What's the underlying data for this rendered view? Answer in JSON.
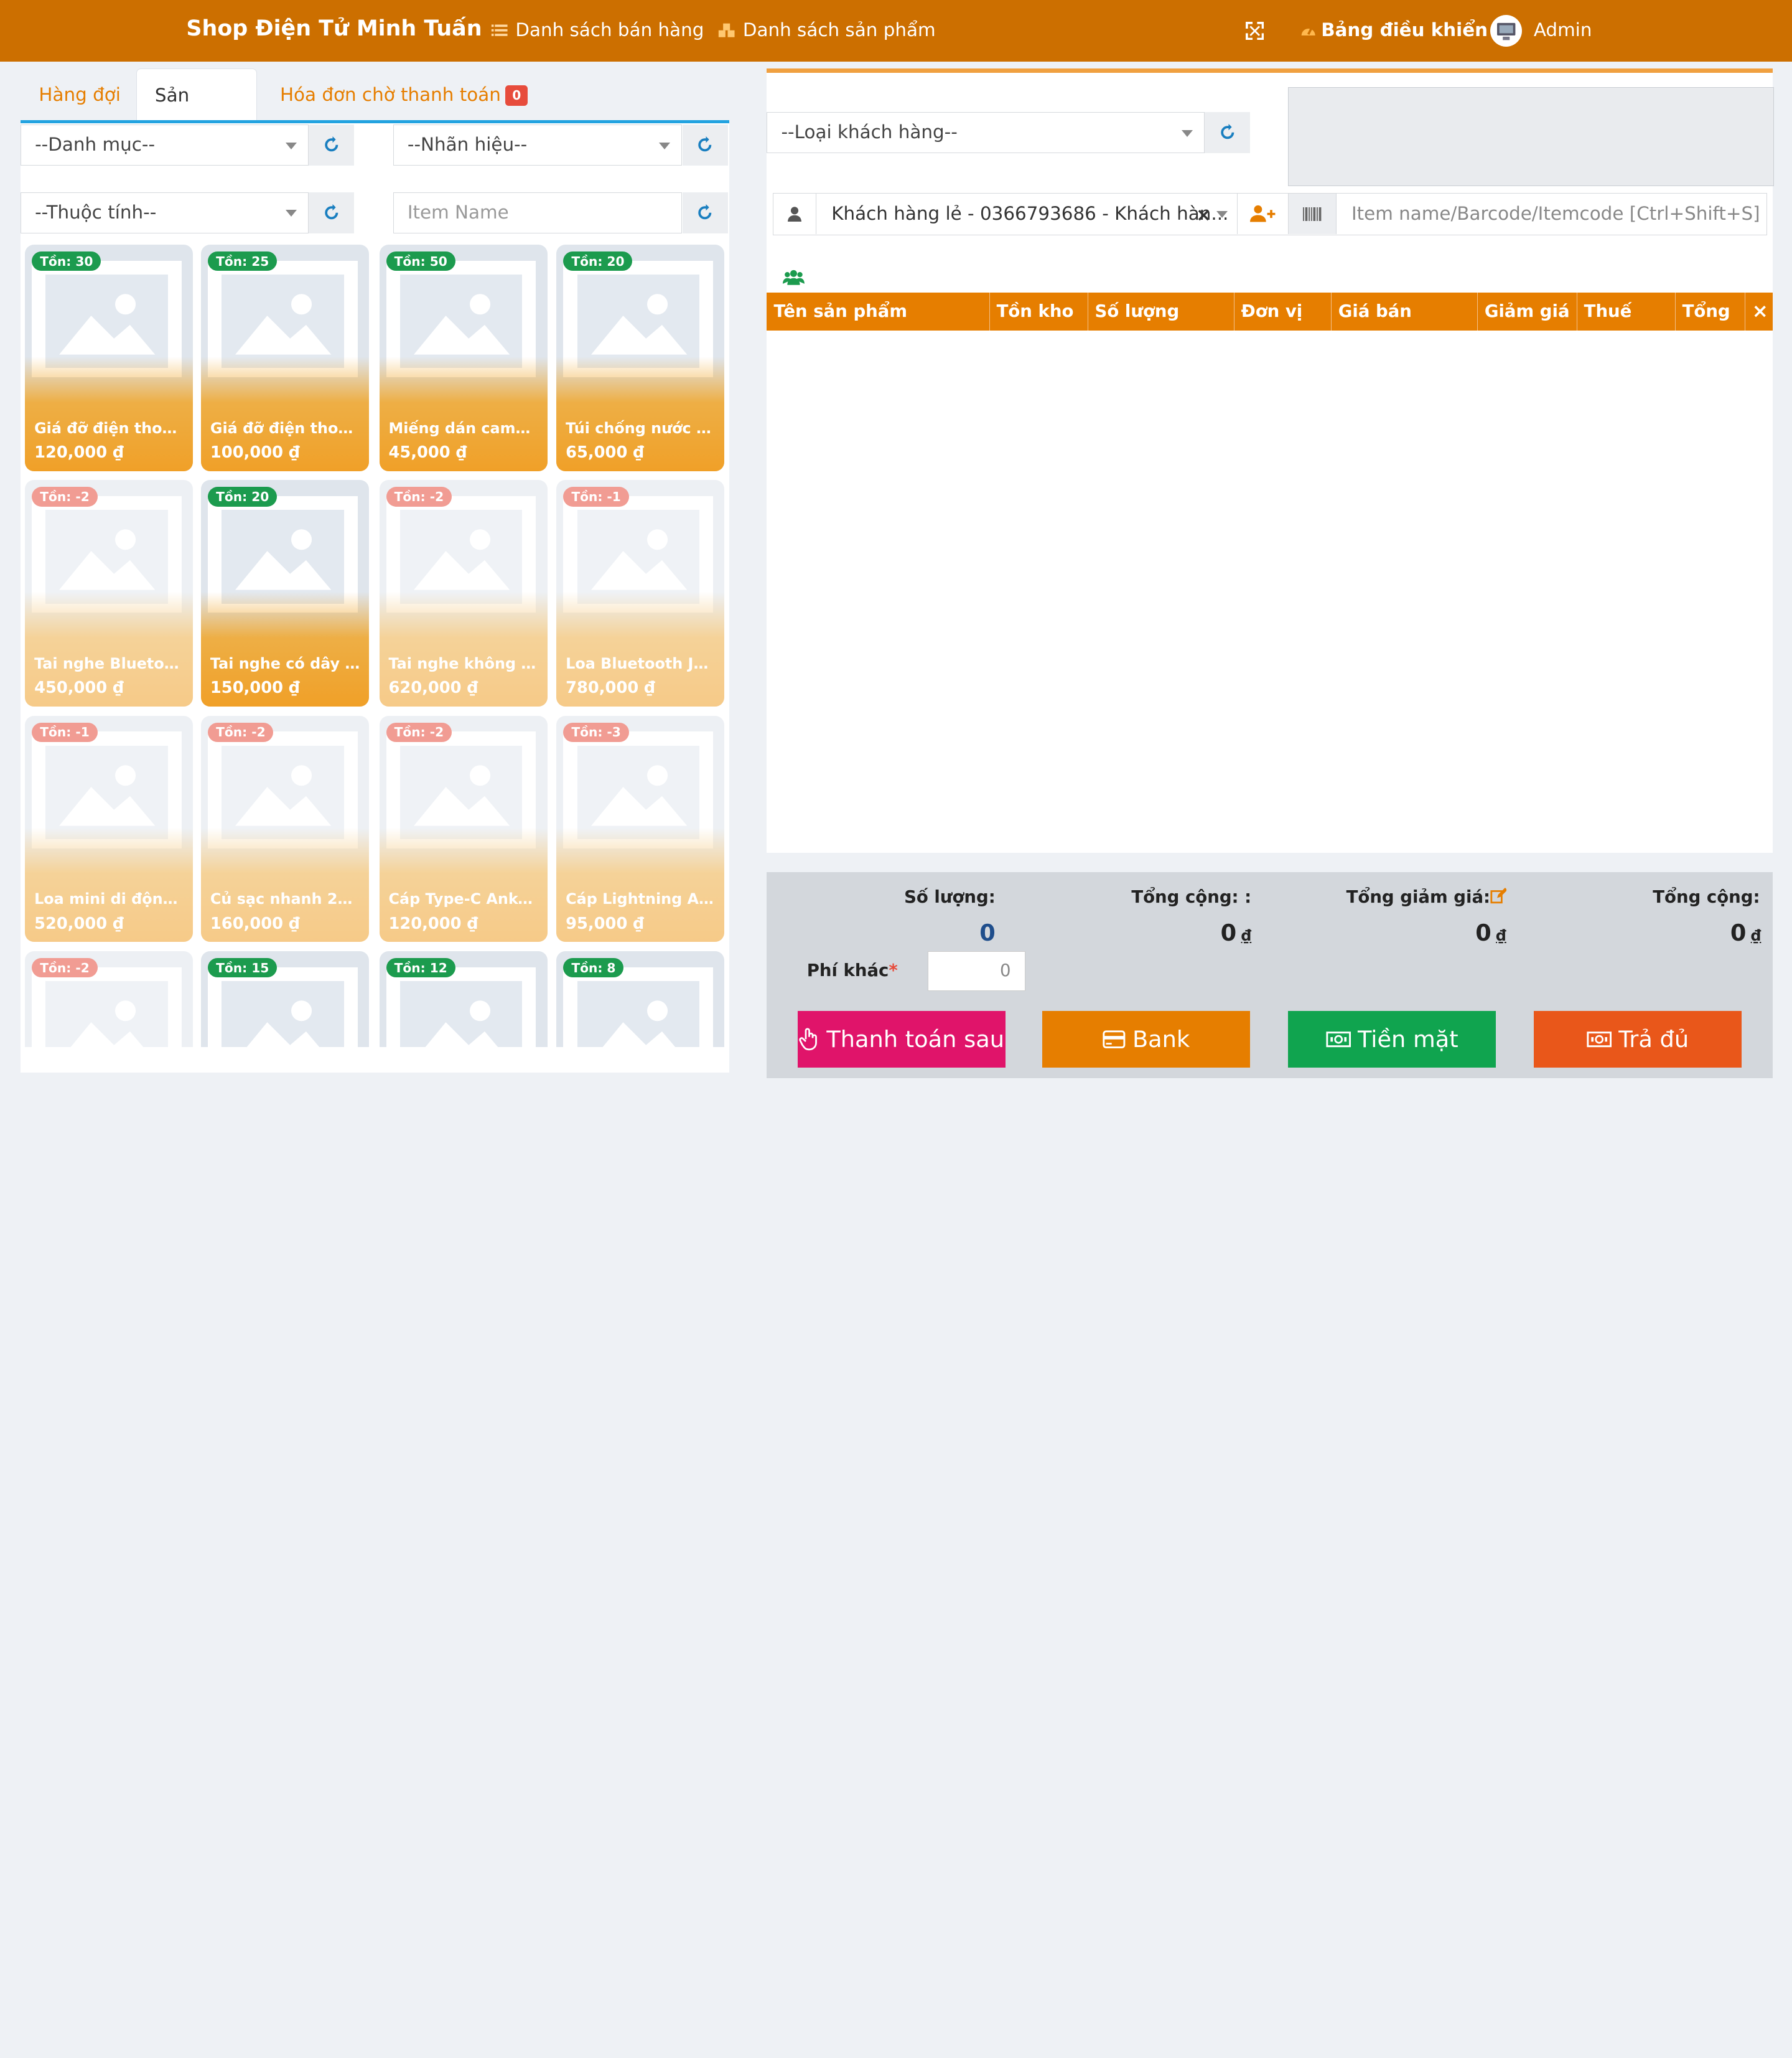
{
  "header": {
    "brand": "Shop Điện Tử Minh Tuấn",
    "nav_sales": "Danh sách bán hàng",
    "nav_products": "Danh sách sản phẩm",
    "dashboard": "Bảng điều khiển",
    "user": "Admin"
  },
  "tabs": {
    "queue": "Hàng đợi",
    "products": "Sản phẩm",
    "pending": "Hóa đơn chờ thanh toán",
    "pending_count": "0"
  },
  "filters": {
    "category": "--Danh mục--",
    "brand": "--Nhãn hiệu--",
    "attribute": "--Thuộc tính--",
    "item_name_placeholder": "Item Name"
  },
  "products": [
    {
      "stock": "Tồn: 30",
      "name": "Giá đỡ điện thoại ...",
      "price": "120,000 ₫",
      "negative": false
    },
    {
      "stock": "Tồn: 25",
      "name": "Giá đỡ điện thoại ...",
      "price": "100,000 ₫",
      "negative": false
    },
    {
      "stock": "Tồn: 50",
      "name": "Miếng dán camer...",
      "price": "45,000 ₫",
      "negative": false
    },
    {
      "stock": "Tồn: 20",
      "name": "Túi chống nước đi...",
      "price": "65,000 ₫",
      "negative": false
    },
    {
      "stock": "Tồn: -2",
      "name": "Tai nghe Bluetoot...",
      "price": "450,000 ₫",
      "negative": true
    },
    {
      "stock": "Tồn: 20",
      "name": "Tai nghe có dây S...",
      "price": "150,000 ₫",
      "negative": false
    },
    {
      "stock": "Tồn: -2",
      "name": "Tai nghe không d...",
      "price": "620,000 ₫",
      "negative": true
    },
    {
      "stock": "Tồn: -1",
      "name": "Loa Bluetooth JBL...",
      "price": "780,000 ₫",
      "negative": true
    },
    {
      "stock": "Tồn: -1",
      "name": "Loa mini di động ...",
      "price": "520,000 ₫",
      "negative": true
    },
    {
      "stock": "Tồn: -2",
      "name": "Củ sạc nhanh 20...",
      "price": "160,000 ₫",
      "negative": true
    },
    {
      "stock": "Tồn: -2",
      "name": "Cáp Type-C Anke...",
      "price": "120,000 ₫",
      "negative": true
    },
    {
      "stock": "Tồn: -3",
      "name": "Cáp Lightning An...",
      "price": "95,000 ₫",
      "negative": true
    },
    {
      "stock": "Tồn: -2",
      "name": "",
      "price": "",
      "negative": true
    },
    {
      "stock": "Tồn: 15",
      "name": "",
      "price": "",
      "negative": false
    },
    {
      "stock": "Tồn: 12",
      "name": "",
      "price": "",
      "negative": false
    },
    {
      "stock": "Tồn: 8",
      "name": "",
      "price": "",
      "negative": false
    }
  ],
  "customer": {
    "type_placeholder": "--Loại khách hàng--",
    "selected": "Khách hàng lẻ - 0366793686 - Khách hàn...",
    "search_placeholder": "Item name/Barcode/Itemcode [Ctrl+Shift+S]"
  },
  "table": {
    "col_name": "Tên sản phẩm",
    "col_stock": "Tồn kho",
    "col_qty": "Số lượng",
    "col_unit": "Đơn vị",
    "col_price": "Giá bán",
    "col_discount": "Giảm giá",
    "col_tax": "Thuế",
    "col_total": "Tổng",
    "col_remove": "×"
  },
  "summary": {
    "qty_label": "Số lượng:",
    "qty_value": "0",
    "subtotal_label": "Tổng cộng: :",
    "subtotal_value": "0",
    "discount_label": "Tổng giảm giá:",
    "discount_value": "0",
    "total_label": "Tổng cộng:",
    "total_value": "0",
    "currency": "₫",
    "fee_label": "Phí khác",
    "fee_required": "*",
    "fee_value": "0"
  },
  "buttons": {
    "pay_later": "Thanh toán sau",
    "bank": "Bank",
    "cash": "Tiền mặt",
    "full": "Trả đủ"
  },
  "colors": {
    "topbar": "#cc6f00",
    "accent": "#e67e00",
    "pay_later": "#e0146a",
    "bank": "#e67e00",
    "cash": "#10a44f",
    "full": "#e9571a",
    "stock_pos": "#1c9b4e",
    "stock_neg": "#e74c3c"
  }
}
